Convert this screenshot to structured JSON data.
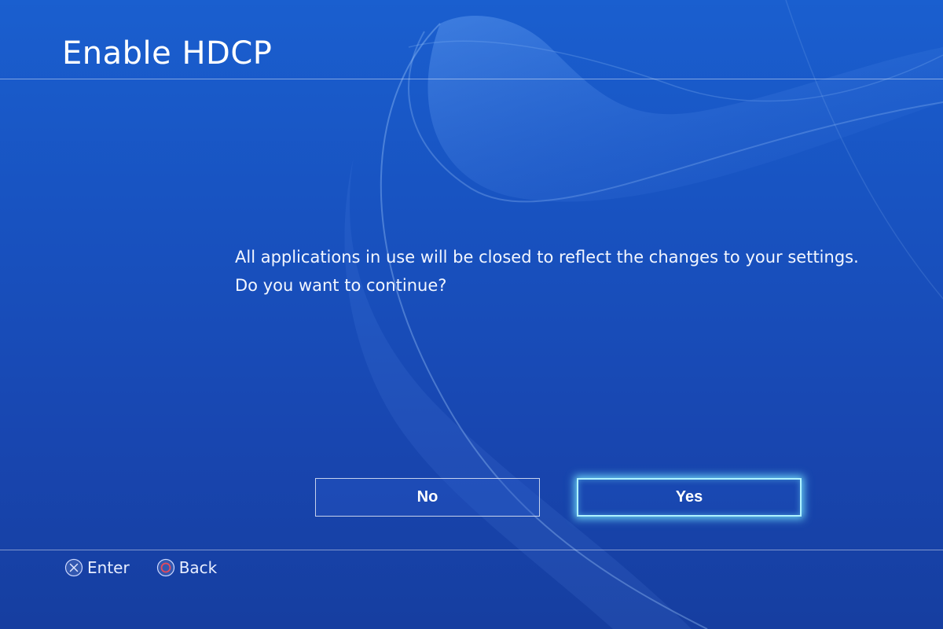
{
  "dialog": {
    "title": "Enable HDCP",
    "message_line1": "All applications in use will be closed to reflect the changes to your settings.",
    "message_line2": "Do you want to continue?"
  },
  "buttons": {
    "no_label": "No",
    "yes_label": "Yes",
    "focused": "Yes"
  },
  "hints": {
    "enter_label": "Enter",
    "enter_icon": "cross-button-icon",
    "back_label": "Back",
    "back_icon": "circle-button-icon"
  },
  "colors": {
    "background": "#1852c0",
    "focus_glow": "#aef2ff",
    "circle_button": "#e8495a"
  }
}
